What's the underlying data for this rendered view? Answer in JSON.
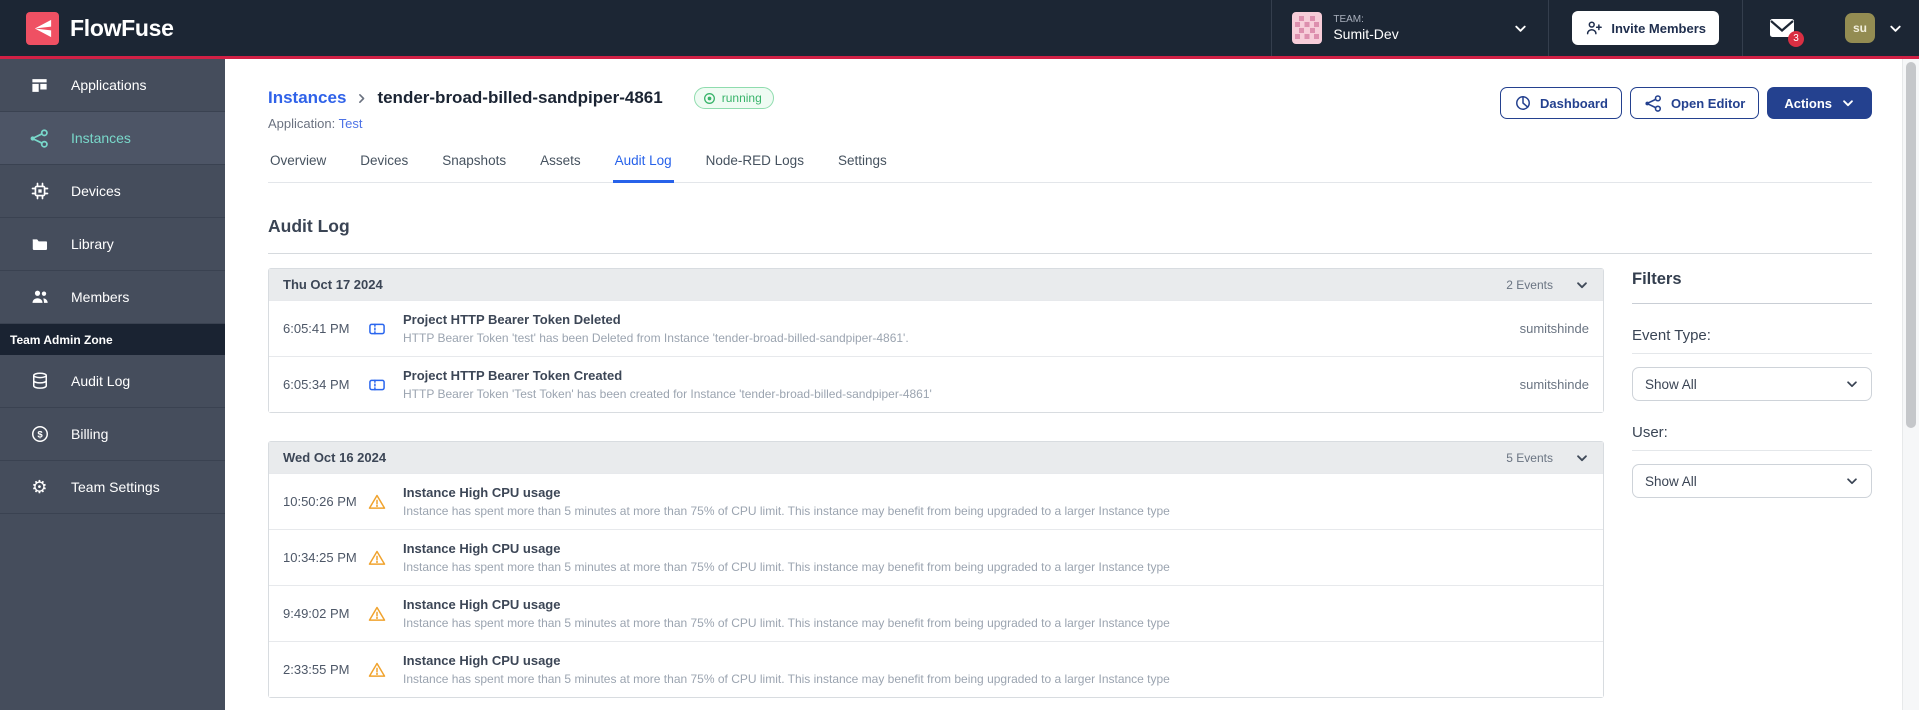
{
  "header": {
    "brand": "FlowFuse",
    "team": {
      "label": "TEAM:",
      "name": "Sumit-Dev"
    },
    "invite_button_label": "Invite Members",
    "notifications_count": "3",
    "avatar_initials": "su"
  },
  "sidebar": {
    "items": [
      {
        "label": "Applications",
        "active": false
      },
      {
        "label": "Instances",
        "active": true
      },
      {
        "label": "Devices",
        "active": false
      },
      {
        "label": "Library",
        "active": false
      },
      {
        "label": "Members",
        "active": false
      }
    ],
    "admin_zone_label": "Team Admin Zone",
    "admin_items": [
      {
        "label": "Audit Log"
      },
      {
        "label": "Billing"
      },
      {
        "label": "Team Settings"
      }
    ]
  },
  "page": {
    "breadcrumb": {
      "parent": "Instances",
      "current": "tender-broad-billed-sandpiper-4861"
    },
    "status_badge": "running",
    "application_label": "Application:",
    "application_name": "Test",
    "buttons": {
      "dashboard": "Dashboard",
      "open_editor": "Open Editor",
      "actions": "Actions"
    },
    "tabs": [
      {
        "label": "Overview",
        "active": false
      },
      {
        "label": "Devices",
        "active": false
      },
      {
        "label": "Snapshots",
        "active": false
      },
      {
        "label": "Assets",
        "active": false
      },
      {
        "label": "Audit Log",
        "active": true
      },
      {
        "label": "Node-RED Logs",
        "active": false
      },
      {
        "label": "Settings",
        "active": false
      }
    ],
    "title": "Audit Log"
  },
  "audit_log": {
    "groups": [
      {
        "date": "Thu Oct 17 2024",
        "events_label": "2 Events",
        "events": [
          {
            "time": "6:05:41 PM",
            "icon": "ticket",
            "title": "Project HTTP Bearer Token Deleted",
            "desc": "HTTP Bearer Token 'test' has been Deleted from Instance 'tender-broad-billed-sandpiper-4861'.",
            "user": "sumitshinde"
          },
          {
            "time": "6:05:34 PM",
            "icon": "ticket",
            "title": "Project HTTP Bearer Token Created",
            "desc": "HTTP Bearer Token 'Test Token' has been created for Instance 'tender-broad-billed-sandpiper-4861'",
            "user": "sumitshinde"
          }
        ]
      },
      {
        "date": "Wed Oct 16 2024",
        "events_label": "5 Events",
        "events": [
          {
            "time": "10:50:26 PM",
            "icon": "warning",
            "title": "Instance High CPU usage",
            "desc": "Instance has spent more than 5 minutes at more than 75% of CPU limit. This instance may benefit from being upgraded to a larger Instance type",
            "user": ""
          },
          {
            "time": "10:34:25 PM",
            "icon": "warning",
            "title": "Instance High CPU usage",
            "desc": "Instance has spent more than 5 minutes at more than 75% of CPU limit. This instance may benefit from being upgraded to a larger Instance type",
            "user": ""
          },
          {
            "time": "9:49:02 PM",
            "icon": "warning",
            "title": "Instance High CPU usage",
            "desc": "Instance has spent more than 5 minutes at more than 75% of CPU limit. This instance may benefit from being upgraded to a larger Instance type",
            "user": ""
          },
          {
            "time": "2:33:55 PM",
            "icon": "warning",
            "title": "Instance High CPU usage",
            "desc": "Instance has spent more than 5 minutes at more than 75% of CPU limit. This instance may benefit from being upgraded to a larger Instance type",
            "user": ""
          }
        ]
      }
    ]
  },
  "filters": {
    "title": "Filters",
    "event_type_label": "Event Type:",
    "event_type_value": "Show All",
    "user_label": "User:",
    "user_value": "Show All"
  },
  "colors": {
    "header_bg": "#1c2634",
    "accent_red_line": "#d12045",
    "brand_red": "#ef5063",
    "sidebar_bg": "#454d5c",
    "active_teal": "#79d8ca",
    "link_blue": "#2f62e9",
    "navy_button": "#24418f",
    "success_green": "#38b36a",
    "warning_amber": "#f0a32e",
    "ticket_blue": "#2a66ee",
    "notification_red": "#da2f43"
  }
}
